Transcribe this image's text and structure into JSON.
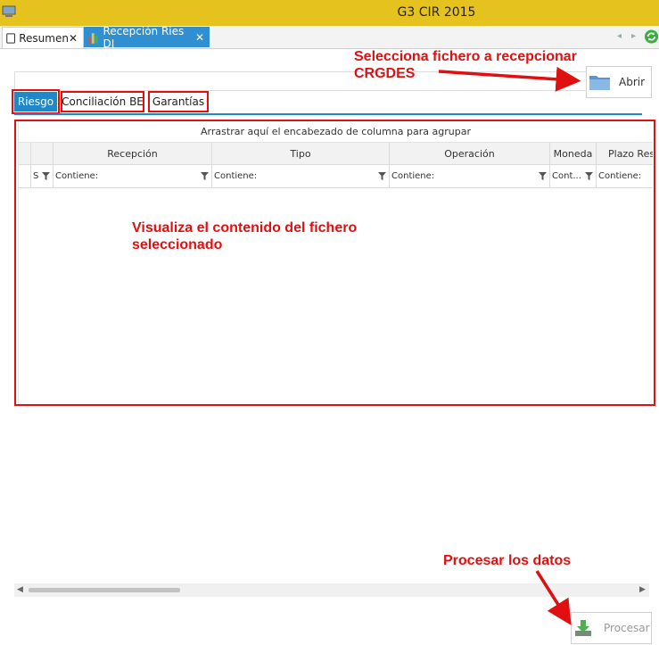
{
  "window": {
    "title": "G3 CIR 2015"
  },
  "doc_tabs": [
    {
      "label": "Resumen",
      "close": "✕"
    },
    {
      "label": "Recepción Ries DI",
      "close": "✕"
    }
  ],
  "toolbar": {
    "open_label": "Abrir",
    "process_label": "Procesar"
  },
  "subtabs": [
    "Riesgo",
    "Conciliación BE",
    "Garantías"
  ],
  "grid": {
    "group_panel_text": "Arrastrar aquí el encabezado de columna para agrupar",
    "columns": [
      "",
      "",
      "Recepción",
      "Tipo",
      "Operación",
      "Moneda",
      "Plazo Res"
    ],
    "filters": [
      "",
      "S",
      "Contiene:",
      "Contiene:",
      "Contiene:",
      "Cont...",
      "Contiene:"
    ]
  },
  "annotations": {
    "open_hint_line1": "Selecciona fichero a recepcionar",
    "open_hint_line2": "CRGDES",
    "content_hint_line1": "Visualiza el contenido del fichero",
    "content_hint_line2": "seleccionado",
    "process_hint": "Procesar los datos"
  },
  "colors": {
    "titlebar": "#e6c21f",
    "accent": "#1e88c8",
    "annotation": "#e01010"
  },
  "icons": [
    "app-icon",
    "document-icon",
    "chart-icon",
    "refresh-icon",
    "folder-icon",
    "filter-icon",
    "download-icon"
  ]
}
